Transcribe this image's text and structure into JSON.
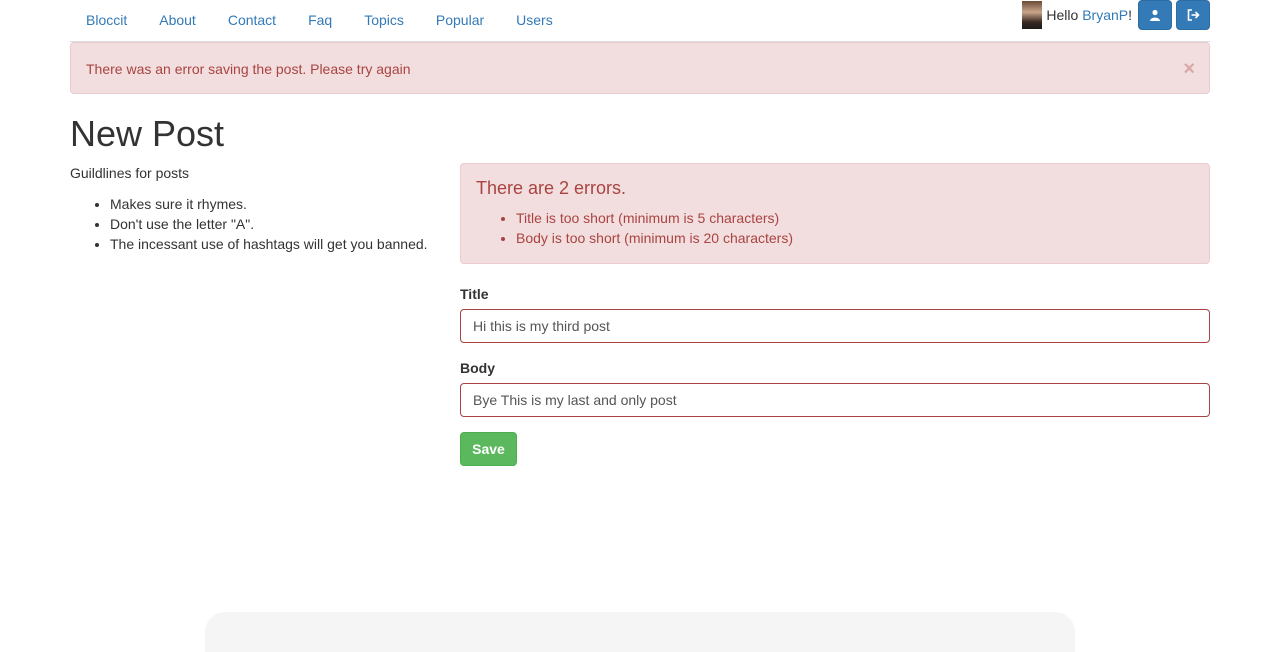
{
  "nav": {
    "links": [
      "Bloccit",
      "About",
      "Contact",
      "Faq",
      "Topics",
      "Popular",
      "Users"
    ],
    "greeting_prefix": "Hello ",
    "user_name": "BryanP",
    "greeting_suffix": "!"
  },
  "flash": {
    "message": "There was an error saving the post. Please try again",
    "close_symbol": "×"
  },
  "page": {
    "title": "New Post"
  },
  "guidelines": {
    "title": "Guildlines for posts",
    "items": [
      "Makes sure it rhymes.",
      "Don't use the letter \"A\".",
      "The incessant use of hashtags will get you banned."
    ]
  },
  "errors": {
    "title": "There are 2 errors.",
    "items": [
      "Title is too short (minimum is 5 characters)",
      "Body is too short (minimum is 20 characters)"
    ]
  },
  "form": {
    "title_label": "Title",
    "title_value": "Hi this is my third post",
    "body_label": "Body",
    "body_value": "Bye This is my last and only post",
    "save_label": "Save"
  },
  "icons": {
    "profile": "user-icon",
    "sign_out": "sign-out-icon"
  },
  "colors": {
    "link": "#337ab7",
    "danger_text": "#a94442",
    "danger_bg": "#f2dede",
    "success": "#5cb85c"
  }
}
